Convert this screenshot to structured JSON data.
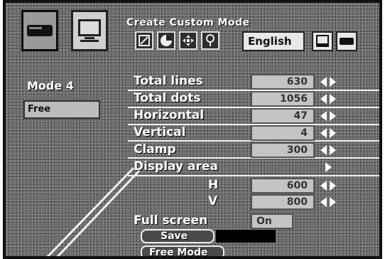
{
  "header": {
    "title": "Create Custom Mode",
    "language": "English",
    "left_icons": [
      "projector-icon",
      "monitor-icon"
    ],
    "toolbar_icons": [
      "image-adjust-icon",
      "color-icon",
      "position-icon",
      "setting-icon"
    ],
    "right_icons": [
      "monitor-small-icon",
      "projector-small-icon"
    ]
  },
  "mode": {
    "name": "Mode 4",
    "value": "Free"
  },
  "settings": [
    {
      "label": "Total lines",
      "value": "630"
    },
    {
      "label": "Total dots",
      "value": "1056"
    },
    {
      "label": "Horizontal",
      "value": "47"
    },
    {
      "label": "Vertical",
      "value": "4"
    },
    {
      "label": "Clamp",
      "value": "300"
    }
  ],
  "display_area": {
    "label": "Display area",
    "h_label": "H",
    "h_value": "600",
    "v_label": "V",
    "v_value": "800"
  },
  "full_screen": {
    "label": "Full screen",
    "value": "On"
  },
  "buttons": {
    "save": "Save",
    "free_mode": "Free Mode"
  }
}
